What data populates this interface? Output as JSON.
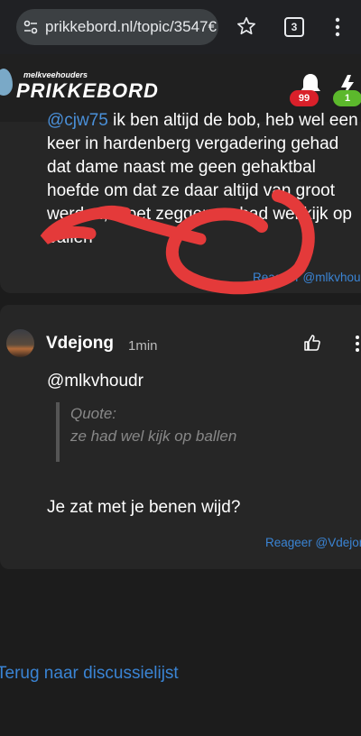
{
  "browser": {
    "url": "prikkebord.nl/topic/3547€",
    "tab_count": "3"
  },
  "app": {
    "logo_sub": "melkveehouders",
    "logo_main": "PRIKKEBORD",
    "notifications_count": "99",
    "activity_count": "1",
    "colors": {
      "notif_badge": "#d9202a",
      "activity_badge": "#5cb82c",
      "link": "#3a84d4"
    }
  },
  "posts": [
    {
      "mention": "@cjw75",
      "text": "ik ben altijd de bob, heb wel een keer in hardenberg vergadering gehad dat dame naast me geen gehaktbal hoefde om dat ze daar altijd van groot werden, moet zeggen ze had wel kijk op ballen",
      "reply_label": "Reageer @mlkvhoudr"
    },
    {
      "author": "Vdejong",
      "time": "1min",
      "mention": "@mlkvhoudr",
      "quote_label": "Quote:",
      "quote_text": "ze had wel kijk op ballen",
      "text": "Je zat met je benen wijd?",
      "reply_label": "Reageer @Vdejong"
    }
  ],
  "footer": {
    "back_link": "Terug naar discussielijst"
  }
}
